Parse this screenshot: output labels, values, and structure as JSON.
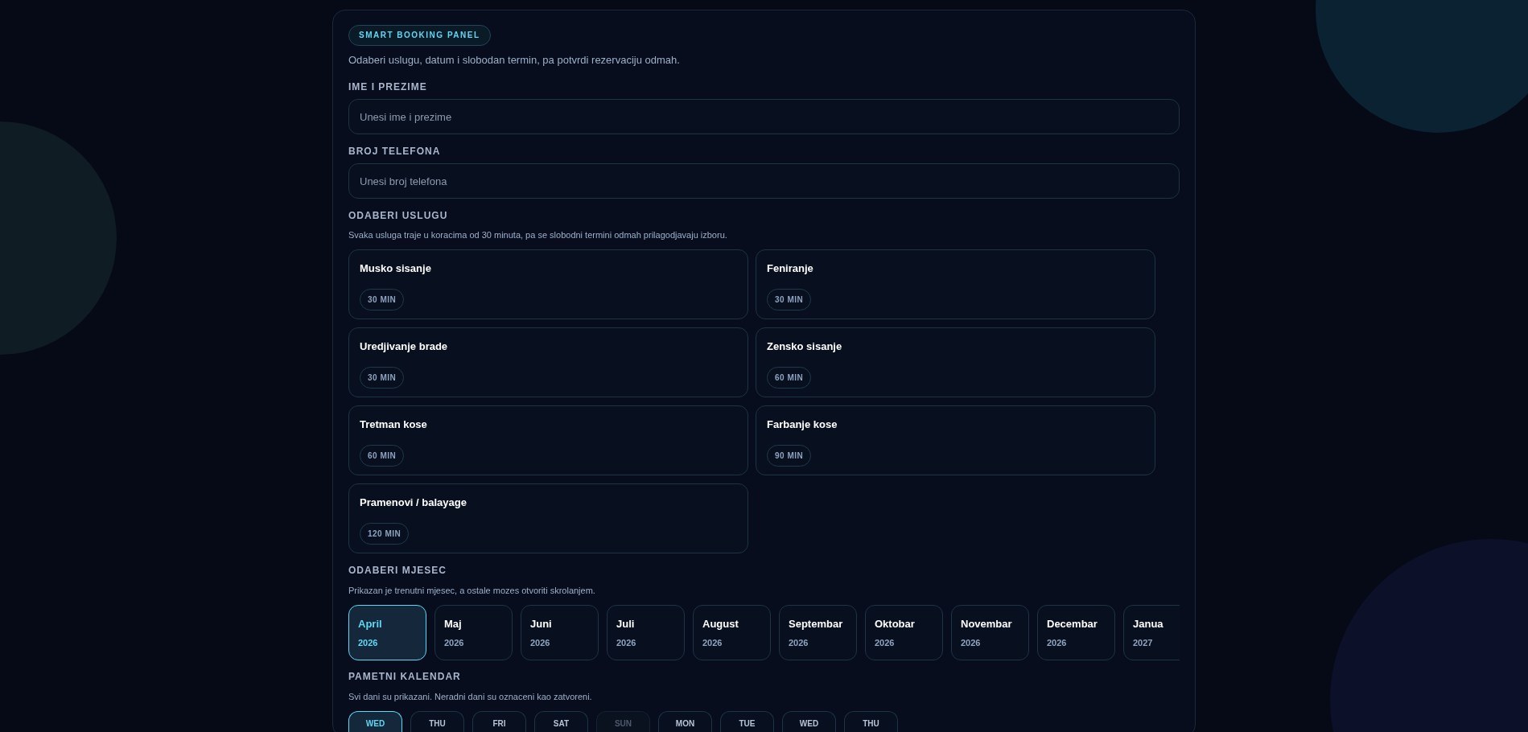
{
  "panel": {
    "badge": "SMART BOOKING PANEL",
    "subtitle": "Odaberi uslugu, datum i slobodan termin, pa potvrdi rezervaciju odmah."
  },
  "fields": [
    {
      "label": "IME I PREZIME",
      "placeholder": "Unesi ime i prezime"
    },
    {
      "label": "BROJ TELEFONA",
      "placeholder": "Unesi broj telefona"
    }
  ],
  "services": {
    "title": "ODABERI USLUGU",
    "description": "Svaka usluga traje u koracima od 30 minuta, pa se slobodni termini odmah prilagodjavaju izboru.",
    "items": [
      {
        "name": "Musko sisanje",
        "duration": "30 MIN"
      },
      {
        "name": "Feniranje",
        "duration": "30 MIN"
      },
      {
        "name": "Uredjivanje brade",
        "duration": "30 MIN"
      },
      {
        "name": "Zensko sisanje",
        "duration": "60 MIN"
      },
      {
        "name": "Tretman kose",
        "duration": "60 MIN"
      },
      {
        "name": "Farbanje kose",
        "duration": "90 MIN"
      },
      {
        "name": "Pramenovi / balayage",
        "duration": "120 MIN"
      }
    ]
  },
  "months": {
    "title": "ODABERI MJESEC",
    "description": "Prikazan je trenutni mjesec, a ostale mozes otvoriti skrolanjem.",
    "items": [
      {
        "name": "April",
        "year": "2026",
        "selected": true
      },
      {
        "name": "Maj",
        "year": "2026",
        "selected": false
      },
      {
        "name": "Juni",
        "year": "2026",
        "selected": false
      },
      {
        "name": "Juli",
        "year": "2026",
        "selected": false
      },
      {
        "name": "August",
        "year": "2026",
        "selected": false
      },
      {
        "name": "Septembar",
        "year": "2026",
        "selected": false
      },
      {
        "name": "Oktobar",
        "year": "2026",
        "selected": false
      },
      {
        "name": "Novembar",
        "year": "2026",
        "selected": false
      },
      {
        "name": "Decembar",
        "year": "2026",
        "selected": false
      },
      {
        "name": "Janua",
        "year": "2027",
        "selected": false
      }
    ]
  },
  "calendar": {
    "title": "PAMETNI KALENDAR",
    "description": "Svi dani su prikazani. Neradni dani su oznaceni kao zatvoreni.",
    "days": [
      {
        "weekday": "WED",
        "selected": true,
        "closed": false
      },
      {
        "weekday": "THU",
        "selected": false,
        "closed": false
      },
      {
        "weekday": "FRI",
        "selected": false,
        "closed": false
      },
      {
        "weekday": "SAT",
        "selected": false,
        "closed": false
      },
      {
        "weekday": "SUN",
        "selected": false,
        "closed": true
      },
      {
        "weekday": "MON",
        "selected": false,
        "closed": false
      },
      {
        "weekday": "TUE",
        "selected": false,
        "closed": false
      },
      {
        "weekday": "WED",
        "selected": false,
        "closed": false
      },
      {
        "weekday": "THU",
        "selected": false,
        "closed": false
      }
    ]
  }
}
